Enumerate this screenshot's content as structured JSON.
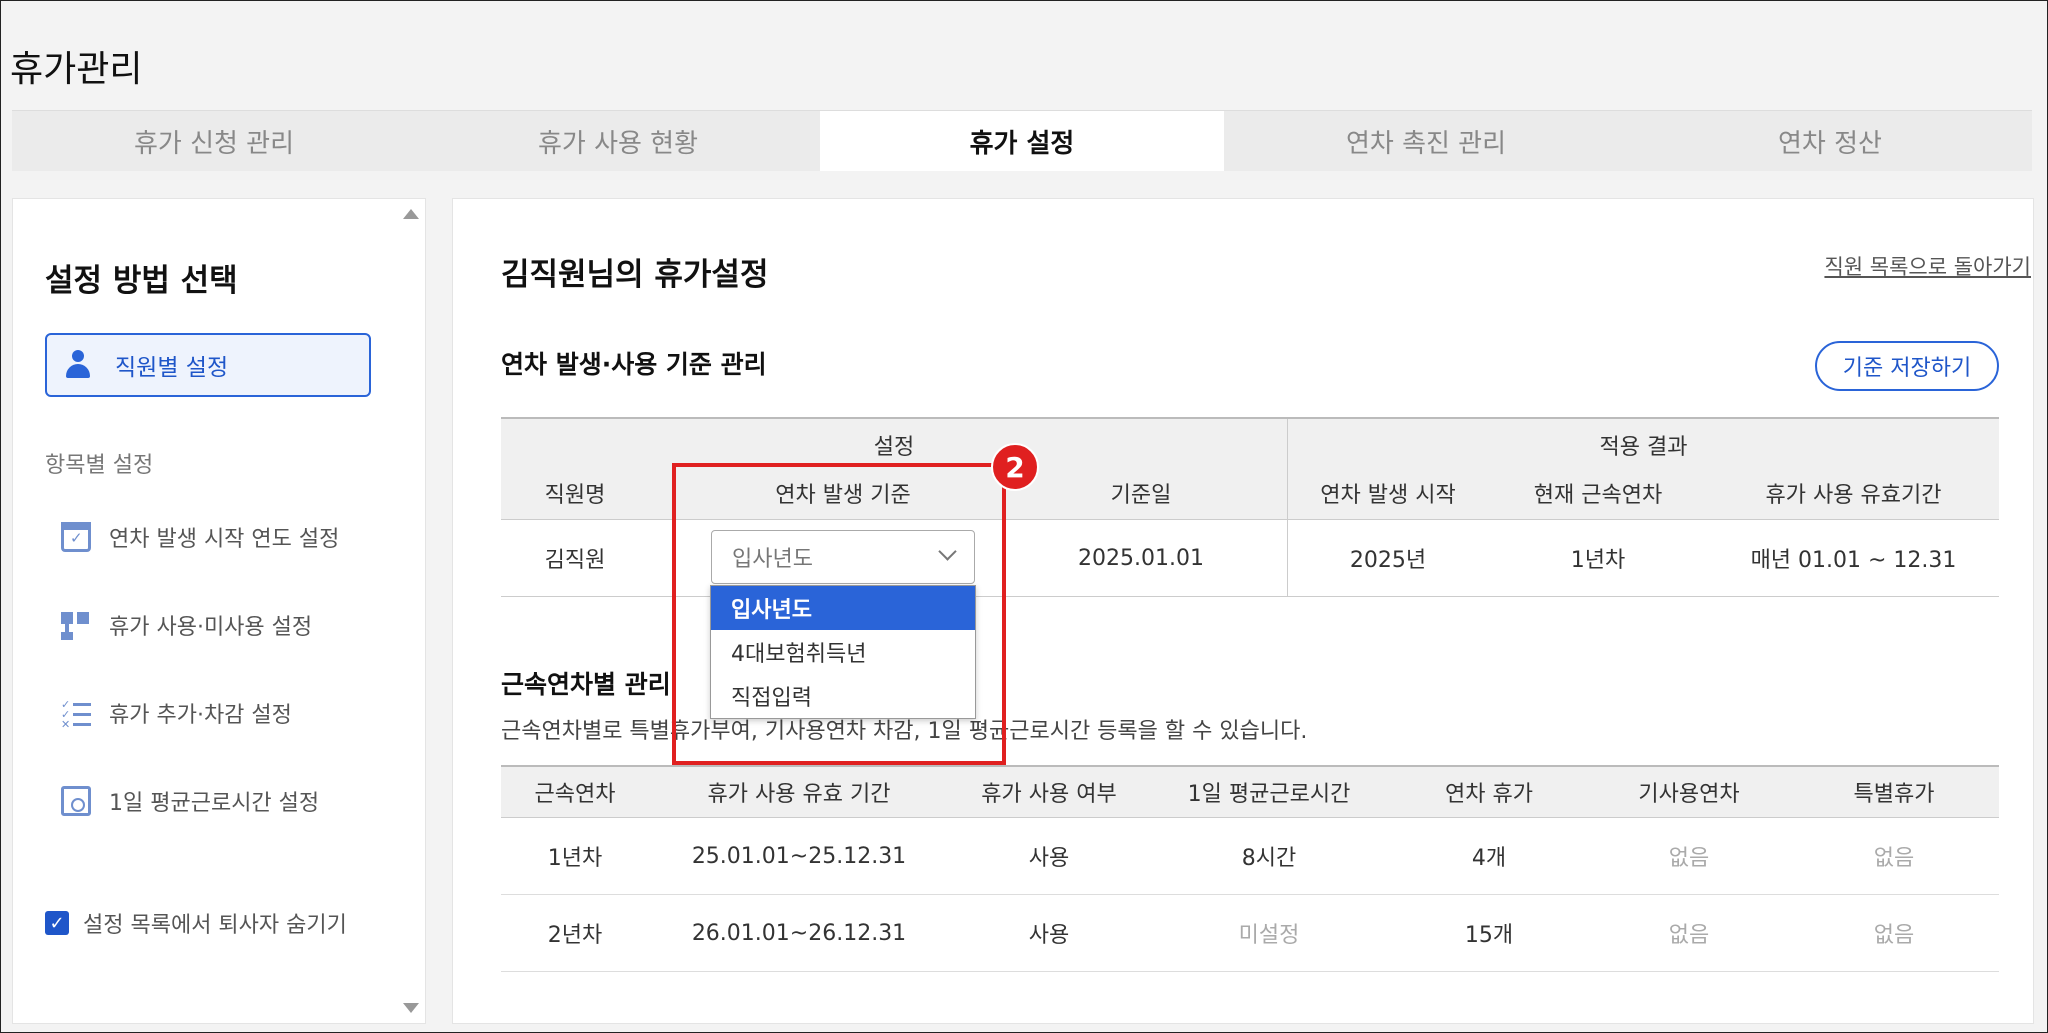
{
  "app": {
    "title": "휴가관리"
  },
  "tabs": [
    {
      "label": "휴가 신청 관리"
    },
    {
      "label": "휴가 사용 현황"
    },
    {
      "label": "휴가 설정",
      "active": true
    },
    {
      "label": "연차 촉진 관리"
    },
    {
      "label": "연차 정산"
    }
  ],
  "sidebar": {
    "title": "설정 방법 선택",
    "primary_button": "직원별 설정",
    "subtitle": "항목별 설정",
    "items": [
      {
        "label": "연차 발생 시작 연도 설정",
        "icon": "calendar-check-icon"
      },
      {
        "label": "휴가 사용·미사용 설정",
        "icon": "flow-icon"
      },
      {
        "label": "휴가 추가·차감 설정",
        "icon": "checklist-icon"
      },
      {
        "label": "1일 평균근로시간 설정",
        "icon": "clock-icon"
      }
    ],
    "checkbox": {
      "label": "설정 목록에서 퇴사자 숨기기",
      "checked": true
    }
  },
  "main": {
    "title": "김직원님의 휴가설정",
    "back_link": "직원 목록으로 돌아가기",
    "section1": {
      "title": "연차 발생·사용 기준 관리",
      "save_button": "기준 저장하기",
      "group_headers": {
        "settings": "설정",
        "result": "적용 결과"
      },
      "columns": [
        "직원명",
        "연차 발생 기준",
        "기준일",
        "연차 발생 시작",
        "현재 근속연차",
        "휴가 사용 유효기간"
      ],
      "row": {
        "name": "김직원",
        "basis": "입사년도",
        "base_date": "2025.01.01",
        "start_year": "2025년",
        "current_year": "1년차",
        "validity": "매년 01.01 ~ 12.31"
      },
      "dropdown_options": [
        "입사년도",
        "4대보험취득년",
        "직접입력"
      ],
      "dropdown_selected": 0
    },
    "callout_number": "2",
    "section2": {
      "title": "근속연차별 관리",
      "description": "근속연차별로 특별휴가부여, 기사용연차 차감, 1일 평균근로시간 등록을 할 수 있습니다.",
      "columns": [
        "근속연차",
        "휴가 사용 유효 기간",
        "휴가 사용 여부",
        "1일 평균근로시간",
        "연차 휴가",
        "기사용연차",
        "특별휴가"
      ],
      "rows": [
        [
          "1년차",
          "25.01.01~25.12.31",
          "사용",
          "8시간",
          "4개",
          "없음",
          "없음"
        ],
        [
          "2년차",
          "26.01.01~26.12.31",
          "사용",
          "미설정",
          "15개",
          "없음",
          "없음"
        ]
      ]
    }
  },
  "colors": {
    "accent": "#2a64d8",
    "highlight": "#e02020"
  }
}
